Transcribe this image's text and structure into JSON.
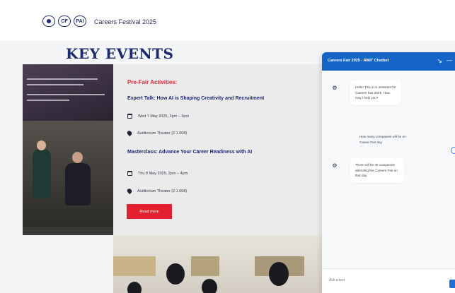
{
  "header": {
    "brand_title": "Careers Festival 2025",
    "logos": [
      {
        "icon": "university-crest-icon",
        "text": ""
      },
      {
        "icon": "partner-logo-icon",
        "text": "CF"
      },
      {
        "icon": "pai-logo-icon",
        "text": "PAI"
      }
    ]
  },
  "page": {
    "title": "KEY EVENTS"
  },
  "event": {
    "section_label": "Pre-Fair Activities:",
    "talks": [
      {
        "title": "Expert Talk: How AI is Shaping Creativity and Recruitment",
        "date": "Wed 7 May 2025, 2pm – 3pm",
        "venue": "Auditorium Theater (2.1.008)"
      },
      {
        "title": "Masterclass: Advance Your Career Readiness with AI",
        "date": "Thu 8 May 2025, 2pm – 4pm",
        "venue": "Auditorium Theater (2.1.008)"
      }
    ],
    "read_more_label": "Read more"
  },
  "chat": {
    "header_title": "Careers Fair 2025 - RMIT Chatbot",
    "minimize_icon": "minimize-icon",
    "close_icon": "close-icon",
    "messages": [
      {
        "from": "bot",
        "text": "Hello! This is AI assistant for Careers Fair 2025. How may I help you?"
      },
      {
        "from": "user",
        "text": "How many companies will be on Career Fair day"
      },
      {
        "from": "bot",
        "text": "There will be 45 companies attending the Careers Fair on that day."
      }
    ],
    "input_placeholder": "Ask a text"
  },
  "colors": {
    "brand_navy": "#1d2a6e",
    "accent_red": "#e2202f",
    "chat_blue": "#1565c7"
  }
}
